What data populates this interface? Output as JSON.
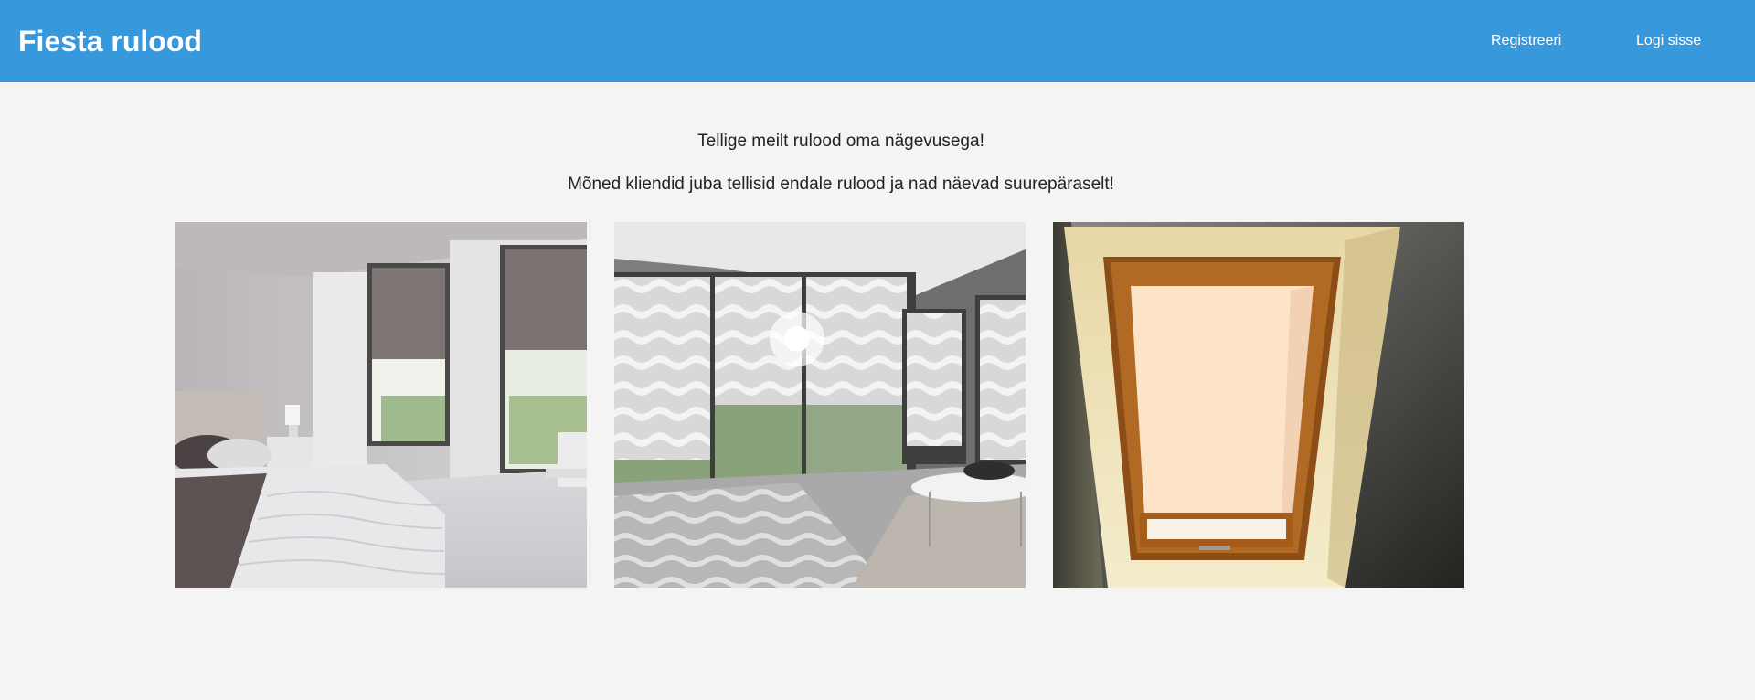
{
  "header": {
    "brand": "Fiesta rulood",
    "nav": [
      {
        "label": "Registreeri"
      },
      {
        "label": "Logi sisse"
      }
    ]
  },
  "main": {
    "intro_line_1": "Tellige meilt rulood oma nägevusega!",
    "intro_line_2": "Mõned kliendid juba tellisid endale rulood ja nad näevad suurepäraselt!"
  },
  "gallery": [
    {
      "subject": "bedroom with grey roller blinds"
    },
    {
      "subject": "living room with wave-patterned zebra blinds"
    },
    {
      "subject": "roof window with beige blackout blind"
    }
  ],
  "colors": {
    "header_bg": "#3798dc",
    "page_bg": "#f4f4f4",
    "header_text": "#ffffff",
    "body_text": "#222222"
  }
}
